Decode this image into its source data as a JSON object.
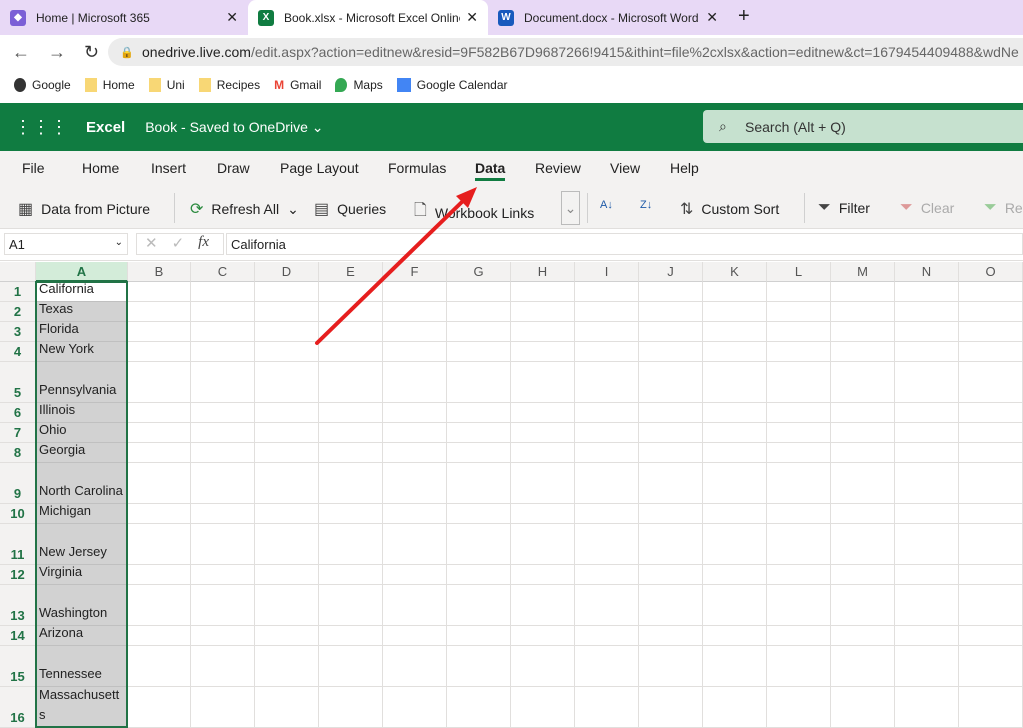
{
  "browser": {
    "tabs": [
      {
        "title": "Home | Microsoft 365"
      },
      {
        "title": "Book.xlsx - Microsoft Excel Online"
      },
      {
        "title": "Document.docx - Microsoft Word"
      }
    ],
    "url_domain": "onedrive.live.com",
    "url_path": "/edit.aspx?action=editnew&resid=9F582B67D9687266!9415&ithint=file%2cxlsx&action=editnew&ct=1679454409488&wdNe",
    "bookmarks": [
      "Google",
      "Home",
      "Uni",
      "Recipes",
      "Gmail",
      "Maps",
      "Google Calendar"
    ]
  },
  "app": {
    "name": "Excel",
    "doc": "Book",
    "status": "Saved to OneDrive",
    "search_placeholder": "Search (Alt + Q)"
  },
  "menu": [
    "File",
    "Home",
    "Insert",
    "Draw",
    "Page Layout",
    "Formulas",
    "Data",
    "Review",
    "View",
    "Help"
  ],
  "active_menu": "Data",
  "ribbon": {
    "data_from_picture": "Data from Picture",
    "refresh_all": "Refresh All",
    "queries": "Queries",
    "workbook_links": "Workbook Links",
    "custom_sort": "Custom Sort",
    "filter": "Filter",
    "clear": "Clear",
    "reapply": "Re"
  },
  "formula_bar": {
    "name_box": "A1",
    "formula": "California"
  },
  "columns": [
    "A",
    "B",
    "C",
    "D",
    "E",
    "F",
    "G",
    "H",
    "I",
    "J",
    "K",
    "L",
    "M",
    "N",
    "O"
  ],
  "rows": [
    {
      "n": "1",
      "a": "California"
    },
    {
      "n": "2",
      "a": "Texas"
    },
    {
      "n": "3",
      "a": "Florida"
    },
    {
      "n": "4",
      "a": "New York"
    },
    {
      "n": "5",
      "a": "Pennsylvania"
    },
    {
      "n": "6",
      "a": "Illinois"
    },
    {
      "n": "7",
      "a": "Ohio"
    },
    {
      "n": "8",
      "a": "Georgia"
    },
    {
      "n": "9",
      "a": "North Carolina"
    },
    {
      "n": "10",
      "a": "Michigan"
    },
    {
      "n": "11",
      "a": "New Jersey"
    },
    {
      "n": "12",
      "a": "Virginia"
    },
    {
      "n": "13",
      "a": "Washington"
    },
    {
      "n": "14",
      "a": "Arizona"
    },
    {
      "n": "15",
      "a": "Tennessee"
    },
    {
      "n": "16",
      "a": "Massachusetts"
    }
  ],
  "colors": {
    "excel_green": "#107c41",
    "annotation_arrow": "#e61e1e"
  }
}
